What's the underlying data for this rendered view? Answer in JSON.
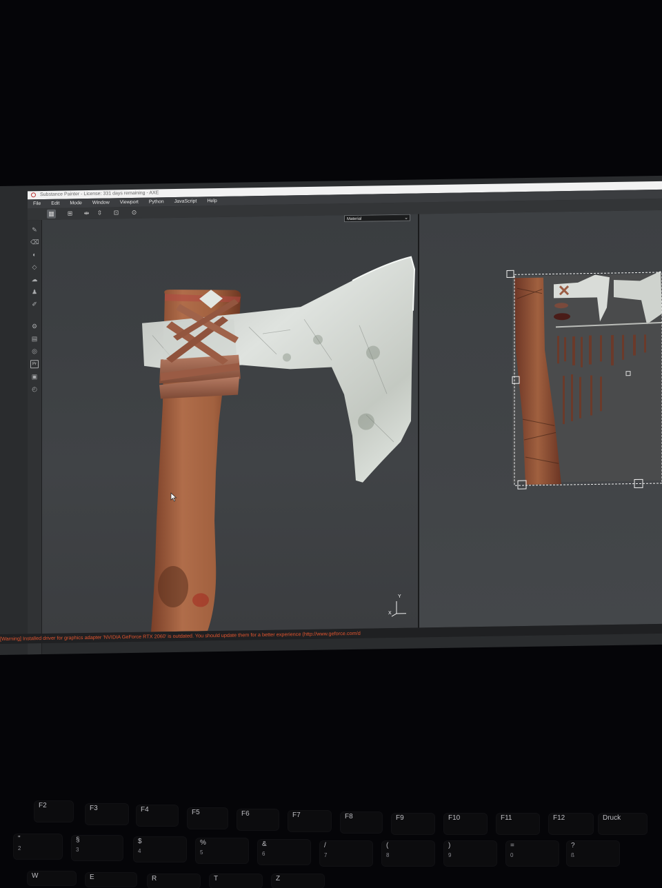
{
  "window": {
    "title": "Substance Painter - License: 331 days remaining - AXE"
  },
  "menu": [
    "File",
    "Edit",
    "Mode",
    "Window",
    "Viewport",
    "Python",
    "JavaScript",
    "Help"
  ],
  "toolbar_icons": [
    "layout-grid-icon",
    "grid-view-icon",
    "mirror-icon",
    "align-icon",
    "frame-icon",
    "camera-icon"
  ],
  "side_tools": [
    "brush-icon",
    "eraser-icon",
    "projection-icon",
    "polygon-fill-icon",
    "smudge-icon",
    "clone-icon",
    "color-picker-icon",
    "settings-icon",
    "layers-icon",
    "camera-icon",
    "pr-icon",
    "save-icon",
    "history-icon"
  ],
  "viewport3d": {
    "channel_select": "Material",
    "axis_labels": {
      "y": "Y",
      "x": "X"
    }
  },
  "status_message": "[Warning] Installed driver for graphics adapter 'NVIDIA GeForce RTX 2060' is outdated. You should update them for a better experience (http://www.geforce.com/d",
  "keyboard": {
    "fn_row": [
      "F2",
      "F3",
      "F4",
      "F5",
      "F6",
      "F7",
      "F8",
      "F9",
      "F10",
      "F11",
      "F12",
      "Druck"
    ],
    "number_row": [
      "2",
      "3",
      "4",
      "5",
      "6",
      "7",
      "8",
      "9",
      "0",
      "ß"
    ],
    "number_row_shift": [
      "\"",
      "§",
      "$",
      "%",
      "&",
      "/",
      "(",
      ")",
      "=",
      "?"
    ],
    "letter_row": [
      "W",
      "E",
      "R",
      "T",
      "Z"
    ]
  },
  "colors": {
    "warning_text": "#e2552f",
    "viewport_bg": "#3e4144",
    "blade_metal": "#c8ccc9",
    "handle_wood": "#9a5c3e"
  }
}
